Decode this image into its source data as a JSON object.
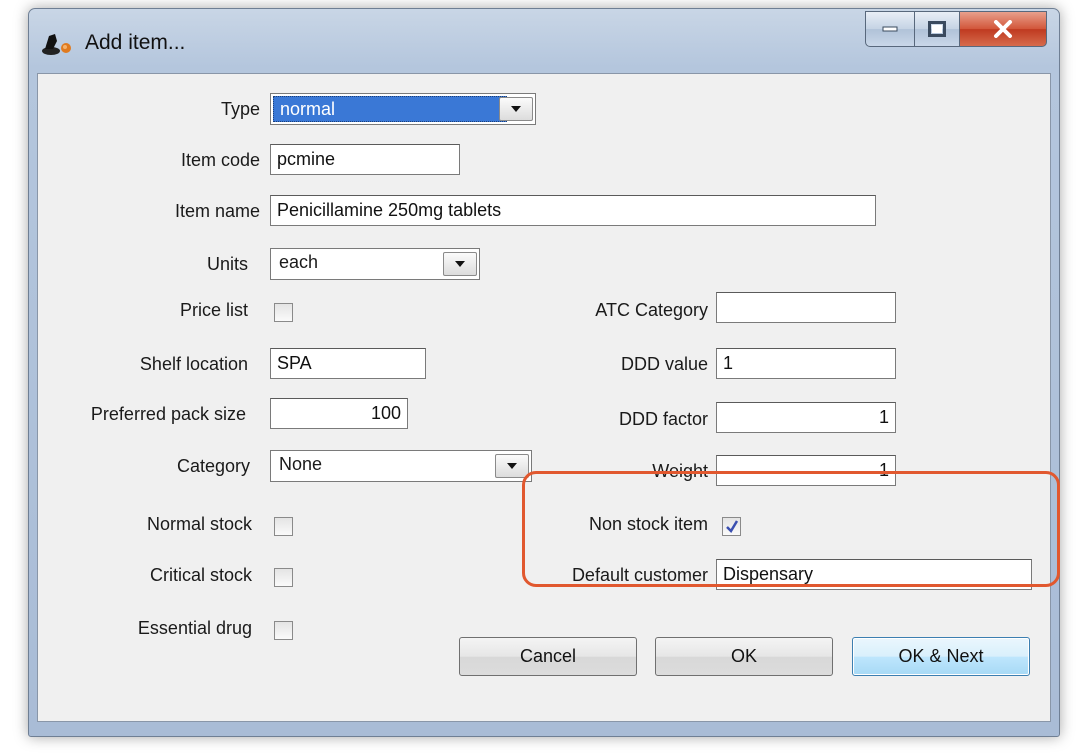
{
  "window": {
    "title": "Add item..."
  },
  "form": {
    "type": {
      "label": "Type",
      "value": "normal"
    },
    "item_code": {
      "label": "Item code",
      "value": "pcmine"
    },
    "item_name": {
      "label": "Item name",
      "value": "Penicillamine 250mg tablets"
    },
    "units": {
      "label": "Units",
      "value": "each"
    },
    "price_list": {
      "label": "Price list",
      "checked": false
    },
    "shelf_location": {
      "label": "Shelf location",
      "value": "SPA"
    },
    "preferred_pack_size": {
      "label": "Preferred pack size",
      "value": "100"
    },
    "category": {
      "label": "Category",
      "value": "None"
    },
    "normal_stock": {
      "label": "Normal stock",
      "checked": false
    },
    "critical_stock": {
      "label": "Critical stock",
      "checked": false
    },
    "essential_drug": {
      "label": "Essential drug",
      "checked": false
    },
    "atc_category": {
      "label": "ATC Category",
      "value": ""
    },
    "ddd_value": {
      "label": "DDD value",
      "value": "1"
    },
    "ddd_factor": {
      "label": "DDD factor",
      "value": "1"
    },
    "weight": {
      "label": "Weight",
      "value": "1"
    },
    "non_stock_item": {
      "label": "Non stock item",
      "checked": true
    },
    "default_customer": {
      "label": "Default customer",
      "value": "Dispensary"
    }
  },
  "buttons": {
    "cancel": "Cancel",
    "ok": "OK",
    "ok_next": "OK & Next"
  },
  "colors": {
    "highlight": "#e1582f",
    "selection": "#3a78d6",
    "close_button": "#c9452a"
  },
  "icons": [
    "app-icon",
    "minimize-icon",
    "maximize-icon",
    "close-icon",
    "dropdown-arrow-icon",
    "checkmark-icon"
  ]
}
